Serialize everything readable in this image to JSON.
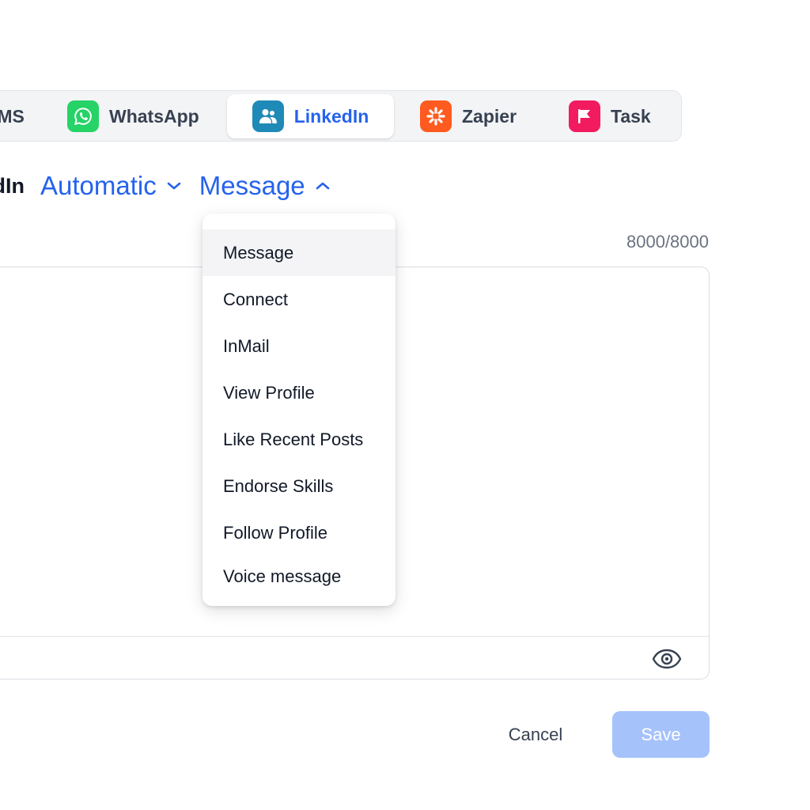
{
  "tabs": [
    {
      "label": "SMS",
      "icon": "sms-icon",
      "active": false
    },
    {
      "label": "WhatsApp",
      "icon": "whatsapp-icon",
      "color": "#25d366",
      "active": false
    },
    {
      "label": "LinkedIn",
      "icon": "linkedin-users-icon",
      "color": "#1f8ab7",
      "active": true
    },
    {
      "label": "Zapier",
      "icon": "zapier-icon",
      "color": "#ff5a1f",
      "active": false
    },
    {
      "label": "Task",
      "icon": "flag-icon",
      "color": "#f21b5f",
      "active": false
    }
  ],
  "step": {
    "prefix": "LinkedIn",
    "mode_label": "Automatic",
    "action_label": "Message"
  },
  "editor": {
    "char_count": "8000/8000",
    "preview_icon": "eye-icon"
  },
  "dropdown": {
    "selected": "Message",
    "items": [
      "Message",
      "Connect",
      "InMail",
      "View Profile",
      "Like Recent Posts",
      "Endorse Skills",
      "Follow Profile",
      "Voice message"
    ]
  },
  "actions": {
    "cancel_label": "Cancel",
    "save_label": "Save"
  },
  "colors": {
    "accent": "#2563eb",
    "save_disabled": "#a6c2fb"
  }
}
